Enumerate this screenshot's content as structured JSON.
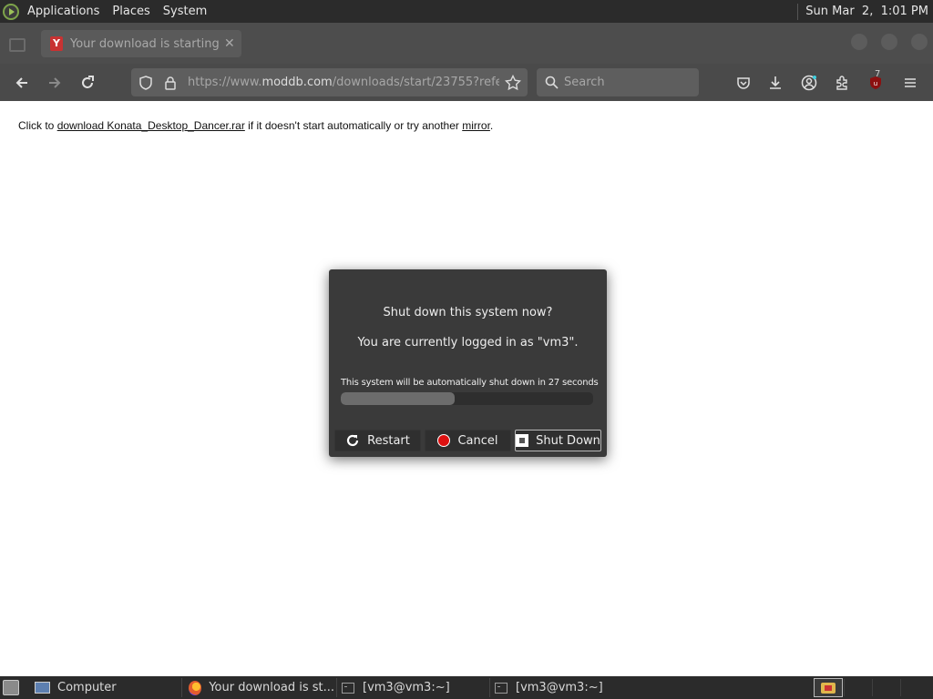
{
  "top_panel": {
    "menus": [
      "Applications",
      "Places",
      "System"
    ],
    "clock": "Sun Mar  2,  1:01 PM"
  },
  "browser": {
    "tab": {
      "title": "Your download is starting - I",
      "favicon_letter": "Y",
      "close": "✕"
    },
    "url": {
      "prefix": "https://www.",
      "host": "moddb.com",
      "path": "/downloads/start/23755?refe"
    },
    "search_placeholder": "Search",
    "ublock_badge": "7"
  },
  "page": {
    "line_prefix": "Click to ",
    "download_link": "download Konata_Desktop_Dancer.rar",
    "line_middle": " if it doesn't start automatically or try another ",
    "mirror_link": "mirror",
    "line_suffix": "."
  },
  "dialog": {
    "question": "Shut down this system now?",
    "logged_in": "You are currently logged in as \"vm3\".",
    "countdown": "This system will be automatically shut down in 27 seconds",
    "progress_fraction": 0.45,
    "buttons": {
      "restart": "Restart",
      "cancel": "Cancel",
      "shutdown": "Shut Down"
    }
  },
  "taskbar": {
    "tasks": [
      "Computer",
      "Your download is st...",
      "[vm3@vm3:~]",
      "[vm3@vm3:~]"
    ]
  },
  "colors": {
    "dialog_bg": "#3a3a3a",
    "panel_bg": "#2b2b2b",
    "cancel_red": "#dd1111"
  }
}
